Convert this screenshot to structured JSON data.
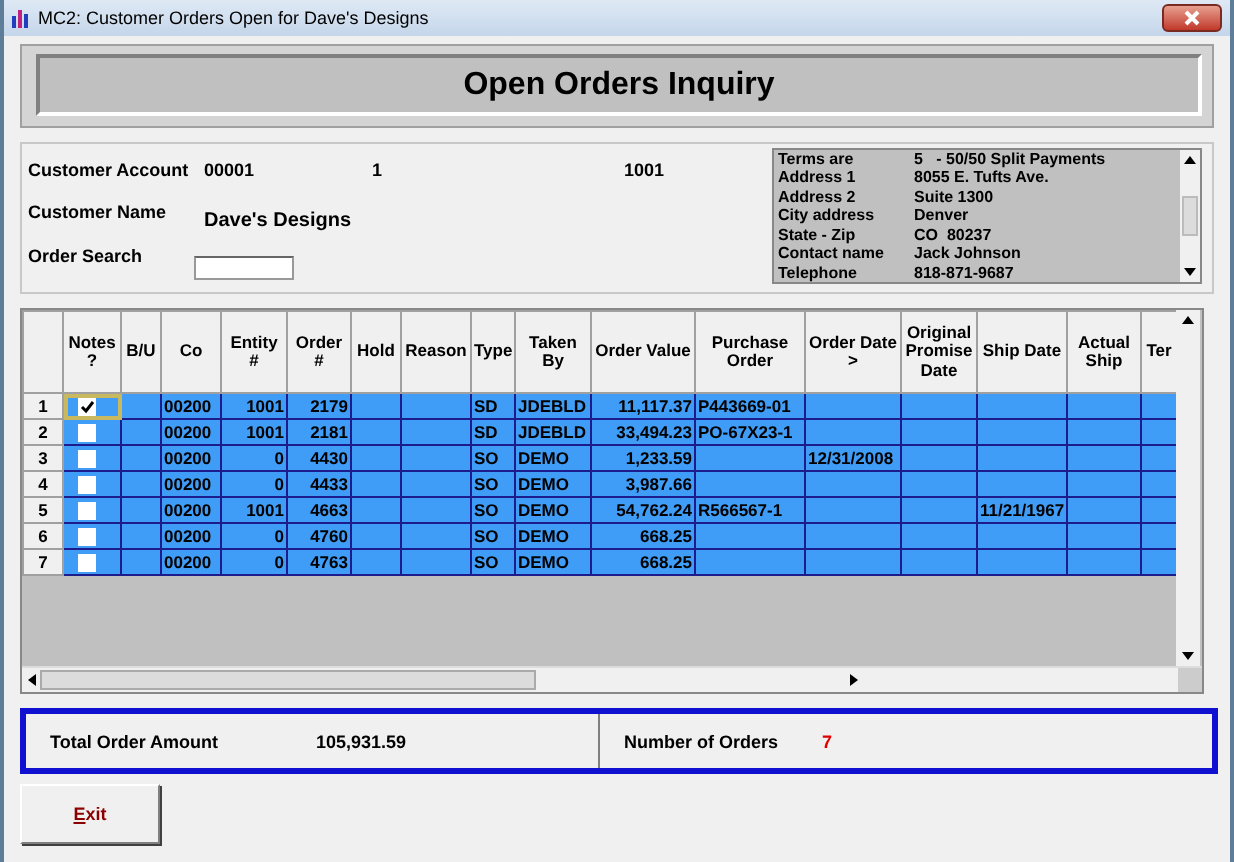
{
  "window": {
    "title": "MC2: Customer Orders Open for Dave's Designs"
  },
  "header": {
    "title": "Open Orders Inquiry"
  },
  "customer": {
    "account_label": "Customer Account",
    "account_values": [
      "00001",
      "1",
      "1001"
    ],
    "name_label": "Customer Name",
    "name_value": "Dave's Designs",
    "search_label": "Order Search"
  },
  "info": [
    {
      "label": "Terms are",
      "value": "5   - 50/50 Split Payments"
    },
    {
      "label": "Address 1",
      "value": "8055 E. Tufts Ave."
    },
    {
      "label": "Address 2",
      "value": "Suite 1300"
    },
    {
      "label": "City address",
      "value": "Denver"
    },
    {
      "label": "State - Zip",
      "value": "CO  80237"
    },
    {
      "label": "Contact name",
      "value": "Jack Johnson"
    },
    {
      "label": "Telephone",
      "value": "818-871-9687"
    }
  ],
  "grid": {
    "columns": [
      {
        "label": "Notes ?",
        "kind": "check"
      },
      {
        "label": "B/U",
        "kind": "text"
      },
      {
        "label": "Co",
        "kind": "text"
      },
      {
        "label": "Entity #",
        "kind": "number"
      },
      {
        "label": "Order #",
        "kind": "number"
      },
      {
        "label": "Hold",
        "kind": "text"
      },
      {
        "label": "Reason",
        "kind": "text"
      },
      {
        "label": "Type",
        "kind": "text"
      },
      {
        "label": "Taken By",
        "kind": "text"
      },
      {
        "label": "Order Value",
        "kind": "number"
      },
      {
        "label": "Purchase Order",
        "kind": "text"
      },
      {
        "label": "Order Date >",
        "kind": "text"
      },
      {
        "label": "Original Promise Date",
        "kind": "text"
      },
      {
        "label": "Ship Date",
        "kind": "text"
      },
      {
        "label": "Actual Ship",
        "kind": "text"
      },
      {
        "label": "Ter",
        "kind": "text"
      }
    ],
    "rows": [
      {
        "number": "1",
        "notes": true,
        "focused": true,
        "cells": [
          "",
          "",
          "00200",
          "1001",
          "2179",
          "",
          "",
          "SD",
          "JDEBLD",
          "11,117.37",
          "P443669-01",
          "",
          "",
          "",
          "",
          ""
        ]
      },
      {
        "number": "2",
        "notes": false,
        "focused": false,
        "cells": [
          "",
          "",
          "00200",
          "1001",
          "2181",
          "",
          "",
          "SD",
          "JDEBLD",
          "33,494.23",
          "PO-67X23-1",
          "",
          "",
          "",
          "",
          ""
        ]
      },
      {
        "number": "3",
        "notes": false,
        "focused": false,
        "cells": [
          "",
          "",
          "00200",
          "0",
          "4430",
          "",
          "",
          "SO",
          "DEMO",
          "1,233.59",
          "",
          "12/31/2008",
          "",
          "",
          "",
          ""
        ]
      },
      {
        "number": "4",
        "notes": false,
        "focused": false,
        "cells": [
          "",
          "",
          "00200",
          "0",
          "4433",
          "",
          "",
          "SO",
          "DEMO",
          "3,987.66",
          "",
          "",
          "",
          "",
          "",
          ""
        ]
      },
      {
        "number": "5",
        "notes": false,
        "focused": false,
        "cells": [
          "",
          "",
          "00200",
          "1001",
          "4663",
          "",
          "",
          "SO",
          "DEMO",
          "54,762.24",
          "R566567-1",
          "",
          "",
          "11/21/1967",
          "",
          ""
        ]
      },
      {
        "number": "6",
        "notes": false,
        "focused": false,
        "cells": [
          "",
          "",
          "00200",
          "0",
          "4760",
          "",
          "",
          "SO",
          "DEMO",
          "668.25",
          "",
          "",
          "",
          "",
          "",
          ""
        ]
      },
      {
        "number": "7",
        "notes": false,
        "focused": false,
        "cells": [
          "",
          "",
          "00200",
          "0",
          "4763",
          "",
          "",
          "SO",
          "DEMO",
          "668.25",
          "",
          "",
          "",
          "",
          "",
          ""
        ]
      }
    ]
  },
  "totals": {
    "amount_label": "Total Order Amount",
    "amount_value": "105,931.59",
    "count_label": "Number of Orders",
    "count_value": "7"
  },
  "exit_button": {
    "accel": "E",
    "rest": "xit"
  }
}
